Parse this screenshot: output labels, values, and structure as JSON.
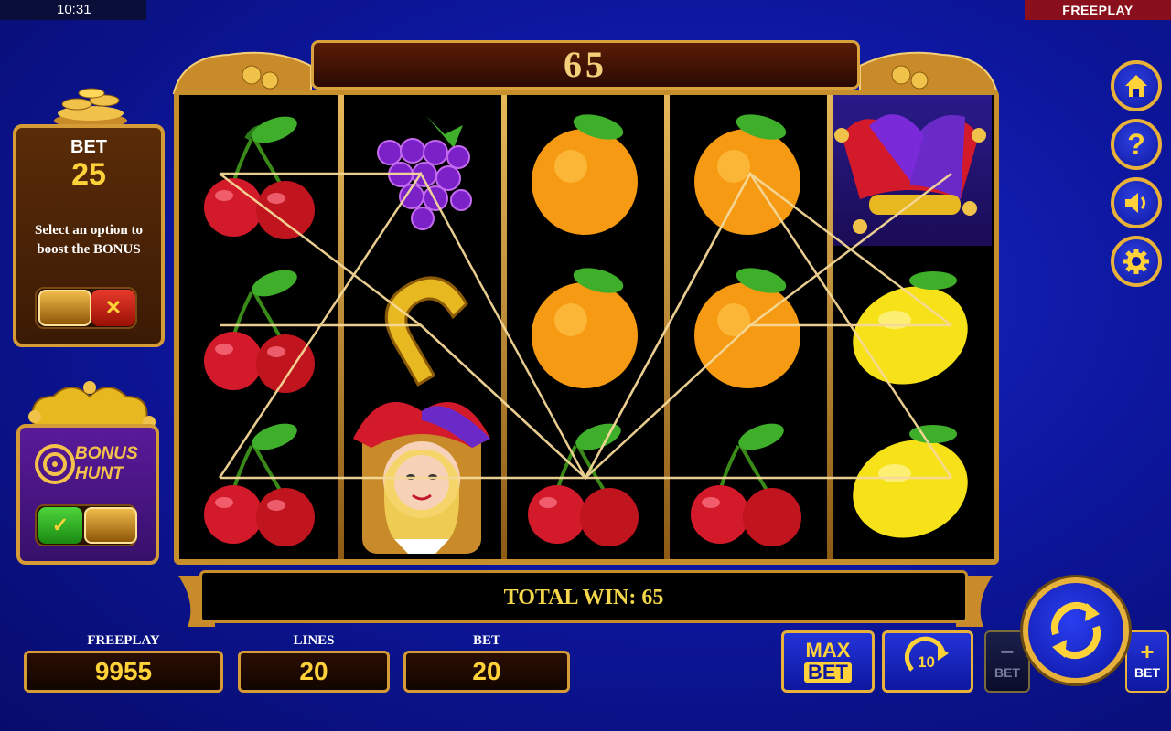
{
  "status_bar": {
    "time": "10:31",
    "mode": "FREEPLAY"
  },
  "win_display": "65",
  "total_win_label": "TOTAL WIN: 65",
  "bet_panel": {
    "label": "BET",
    "value": "25",
    "boost_text": "Select an option to boost the BONUS"
  },
  "bonus_hunt": {
    "title_line1": "BONUS",
    "title_line2": "HUNT"
  },
  "bottom_bar": {
    "freeplay_label": "FREEPLAY",
    "freeplay_value": "9955",
    "lines_label": "LINES",
    "lines_value": "20",
    "bet_label": "BET",
    "bet_value": "20"
  },
  "buttons": {
    "max_line1": "MAX",
    "max_line2": "BET",
    "autospin_count": "10",
    "bet_minus_label": "BET",
    "bet_plus_label": "BET"
  },
  "reels": [
    [
      "cherry",
      "cherry",
      "cherry"
    ],
    [
      "grapes",
      "horseshoe",
      "joker"
    ],
    [
      "orange",
      "orange",
      "cherry"
    ],
    [
      "orange",
      "orange",
      "cherry"
    ],
    [
      "jester-hat",
      "lemon",
      "lemon"
    ]
  ],
  "side_icons": [
    "home-icon",
    "help-icon",
    "sound-icon",
    "settings-icon"
  ],
  "colors": {
    "gold": "#e8b13a",
    "background": "#0d17a0",
    "win_text": "#f4d64a",
    "value_text": "#ffd23a"
  }
}
